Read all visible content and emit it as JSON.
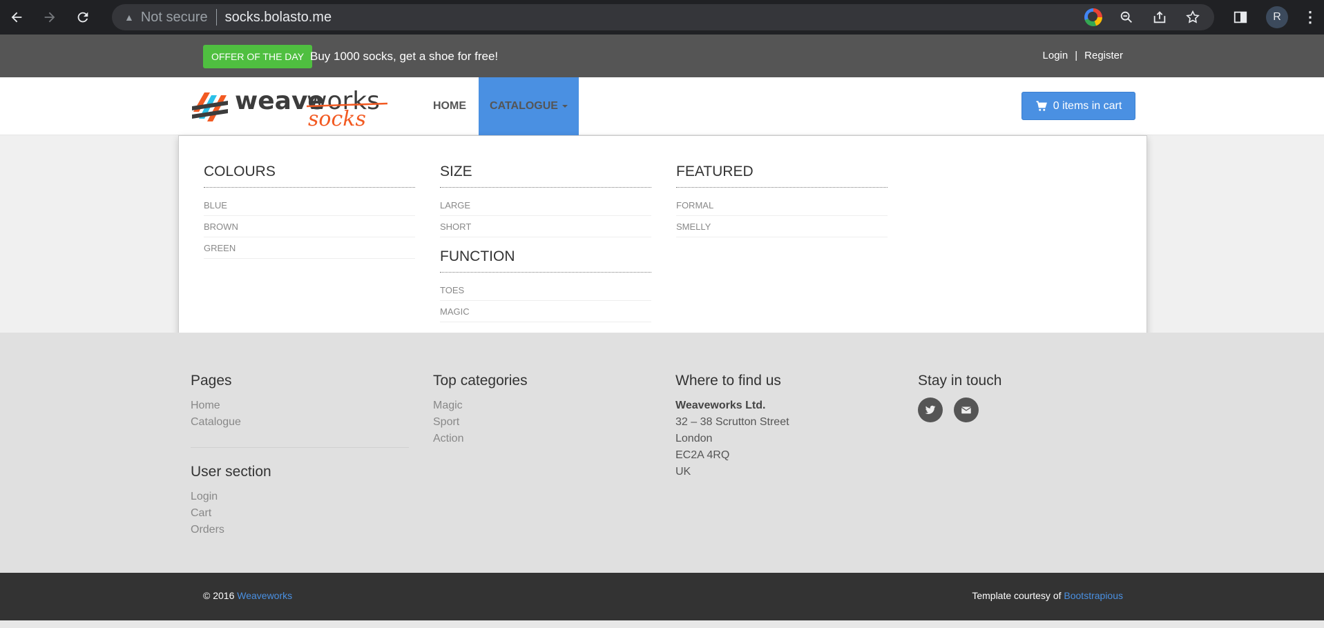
{
  "browser": {
    "security_label": "Not secure",
    "url": "socks.bolasto.me",
    "profile_initial": "R"
  },
  "topbar": {
    "offer_badge": "OFFER OF THE DAY",
    "offer_text": "Buy 1000 socks, get a shoe for free!",
    "login": "Login",
    "separator": "|",
    "register": "Register"
  },
  "navbar": {
    "logo_word1": "weave",
    "logo_word2": "works",
    "logo_word3": "socks",
    "home": "HOME",
    "catalogue": "CATALOGUE",
    "cart": "0 items in cart"
  },
  "catalogue_menu": {
    "colours": {
      "title": "COLOURS",
      "items": [
        "BLUE",
        "BROWN",
        "GREEN"
      ]
    },
    "size": {
      "title": "SIZE",
      "items": [
        "LARGE",
        "SHORT"
      ]
    },
    "function": {
      "title": "FUNCTION",
      "items": [
        "TOES",
        "MAGIC"
      ]
    },
    "featured": {
      "title": "FEATURED",
      "items": [
        "FORMAL",
        "SMELLY"
      ]
    }
  },
  "footer": {
    "pages": {
      "title": "Pages",
      "items": [
        "Home",
        "Catalogue"
      ]
    },
    "user_section": {
      "title": "User section",
      "items": [
        "Login",
        "Cart",
        "Orders"
      ]
    },
    "top_categories": {
      "title": "Top categories",
      "items": [
        "Magic",
        "Sport",
        "Action"
      ]
    },
    "find_us": {
      "title": "Where to find us",
      "company": "Weaveworks Ltd.",
      "lines": [
        "32 – 38 Scrutton Street",
        "London",
        "EC2A 4RQ",
        "UK"
      ]
    },
    "stay_in_touch": {
      "title": "Stay in touch",
      "icons": [
        "twitter-icon",
        "envelope-icon"
      ]
    }
  },
  "copyright": {
    "prefix": "© 2016 ",
    "brand": "Weaveworks",
    "template_prefix": "Template courtesy of ",
    "template_link": "Bootstrapious"
  },
  "colors": {
    "accent_blue": "#4a90e2",
    "offer_green": "#4fbf40",
    "logo_orange": "#f25a22",
    "logo_cyan": "#2bc0e8"
  }
}
